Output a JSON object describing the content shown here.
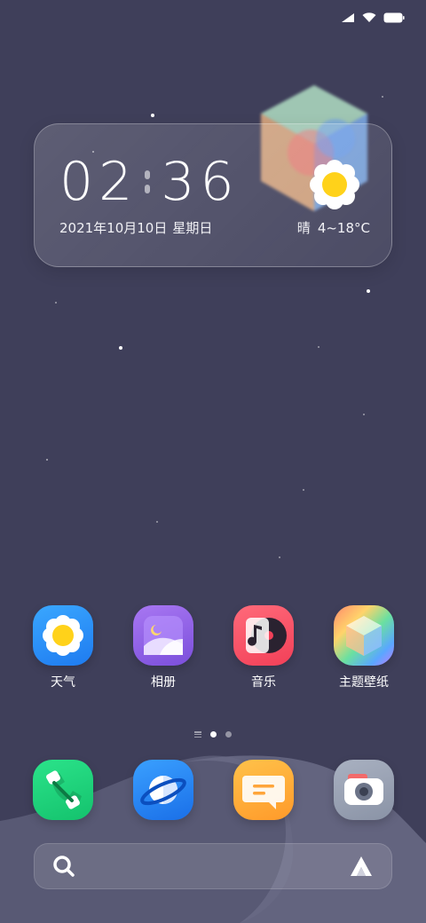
{
  "status_bar": {
    "icons": [
      "signal-icon",
      "wifi-icon",
      "battery-icon"
    ]
  },
  "widget": {
    "time_hours": "02",
    "time_minutes": "36",
    "date": "2021年10月10日",
    "weekday": "星期日",
    "weather_condition": "晴",
    "temperature_range": "4~18°C",
    "weather_icon": "sun-icon"
  },
  "apps": [
    {
      "label": "天气",
      "icon": "weather-icon"
    },
    {
      "label": "相册",
      "icon": "gallery-icon"
    },
    {
      "label": "音乐",
      "icon": "music-icon"
    },
    {
      "label": "主题壁纸",
      "icon": "theme-icon"
    }
  ],
  "page_indicator": {
    "pages": 2,
    "current": 1
  },
  "dock": [
    {
      "icon": "phone-icon"
    },
    {
      "icon": "browser-icon"
    },
    {
      "icon": "messages-icon"
    },
    {
      "icon": "camera-icon"
    }
  ],
  "search": {
    "placeholder": "",
    "search_icon": "search-icon",
    "assistant_icon": "assistant-icon"
  },
  "colors": {
    "background": "#3f3f5a",
    "accent_sun": "#ffd21a"
  }
}
